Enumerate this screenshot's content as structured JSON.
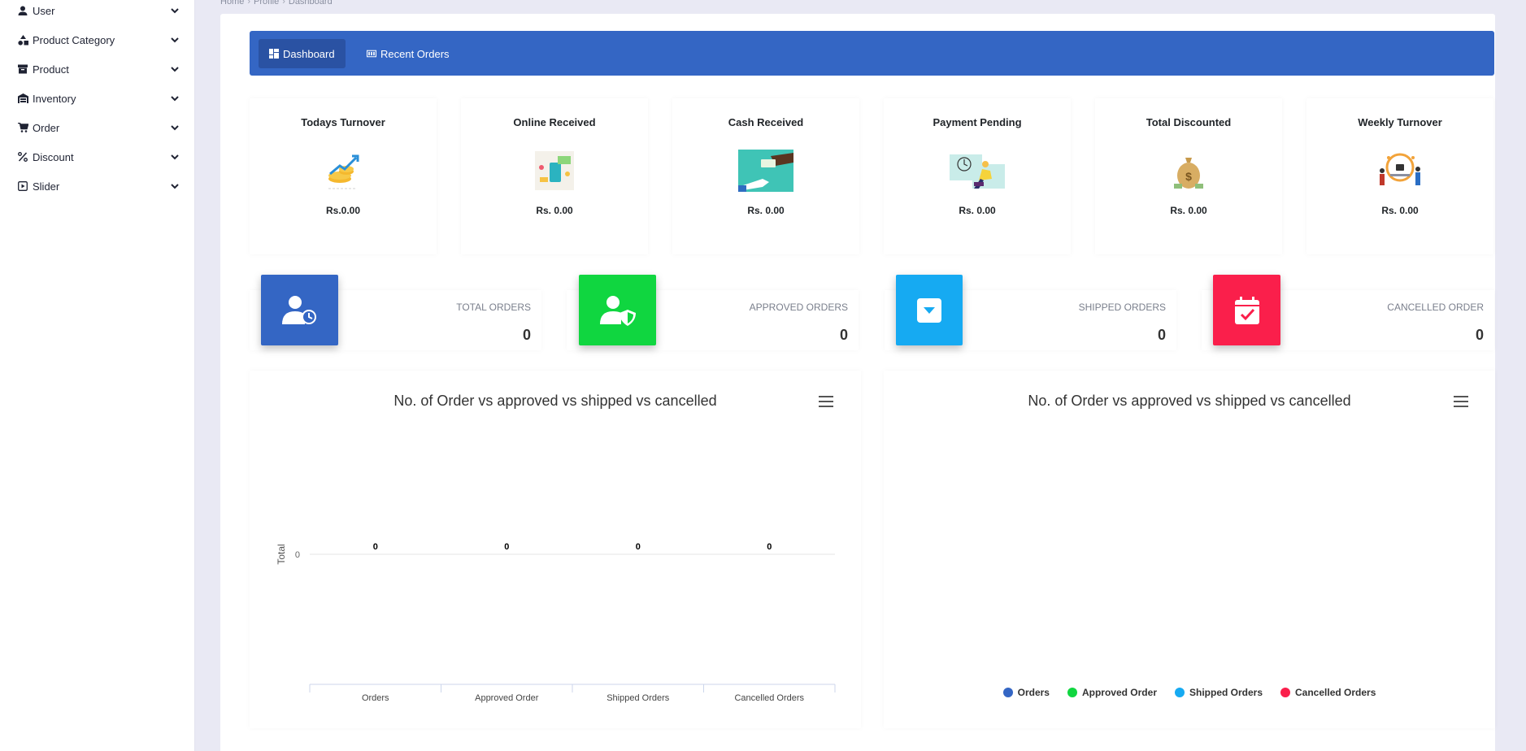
{
  "sidebar": {
    "items": [
      {
        "label": "User",
        "icon": "user-icon"
      },
      {
        "label": "Product Category",
        "icon": "shapes-icon"
      },
      {
        "label": "Product",
        "icon": "archive-icon"
      },
      {
        "label": "Inventory",
        "icon": "warehouse-icon"
      },
      {
        "label": "Order",
        "icon": "cart-icon"
      },
      {
        "label": "Discount",
        "icon": "percent-icon"
      },
      {
        "label": "Slider",
        "icon": "play-square-icon"
      }
    ]
  },
  "breadcrumb": [
    "Home",
    "Profile",
    "Dashboard"
  ],
  "tabs": [
    {
      "label": "Dashboard",
      "icon": "dashboard-icon",
      "active": true
    },
    {
      "label": "Recent Orders",
      "icon": "list-icon",
      "active": false
    }
  ],
  "stats": [
    {
      "title": "Todays Turnover",
      "value": "Rs.0.00"
    },
    {
      "title": "Online Received",
      "value": "Rs. 0.00"
    },
    {
      "title": "Cash Received",
      "value": "Rs. 0.00"
    },
    {
      "title": "Payment Pending",
      "value": "Rs. 0.00"
    },
    {
      "title": "Total Discounted",
      "value": "Rs. 0.00"
    },
    {
      "title": "Weekly Turnover",
      "value": "Rs. 0.00"
    }
  ],
  "orders": [
    {
      "label": "TOTAL ORDERS",
      "value": "0",
      "color": "#3466c4",
      "icon": "user-clock-icon"
    },
    {
      "label": "APPROVED ORDERS",
      "value": "0",
      "color": "#10d640",
      "icon": "user-shield-icon"
    },
    {
      "label": "SHIPPED ORDERS",
      "value": "0",
      "color": "#16aaf2",
      "icon": "caret-box-icon"
    },
    {
      "label": "CANCELLED ORDER",
      "value": "0",
      "color": "#fa1f4b",
      "icon": "calendar-check-icon"
    }
  ],
  "charts": {
    "bar_title": "No. of Order vs approved vs shipped vs cancelled",
    "pie_title": "No. of Order vs approved vs shipped vs cancelled",
    "legend": [
      {
        "label": "Orders",
        "color": "#3466c4"
      },
      {
        "label": "Approved Order",
        "color": "#10d640"
      },
      {
        "label": "Shipped Orders",
        "color": "#16aaf2"
      },
      {
        "label": "Cancelled Orders",
        "color": "#fa1f4b"
      }
    ]
  },
  "chart_data": {
    "type": "bar",
    "title": "No. of Order vs approved vs shipped vs cancelled",
    "categories": [
      "Orders",
      "Approved Order",
      "Shipped Orders",
      "Cancelled Orders"
    ],
    "values": [
      0,
      0,
      0,
      0
    ],
    "ylabel": "Total",
    "xlabel": "",
    "yticks": [
      "0"
    ],
    "grid": true
  }
}
